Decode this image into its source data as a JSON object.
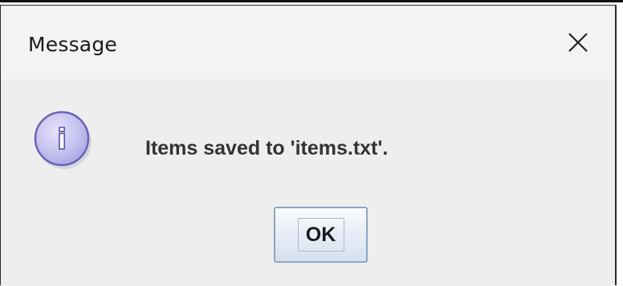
{
  "dialog": {
    "title": "Message",
    "close_icon": "close-icon",
    "info_icon": "info-icon",
    "info_glyph": "i",
    "message": "Items saved to 'items.txt'.",
    "ok_label": "OK"
  }
}
